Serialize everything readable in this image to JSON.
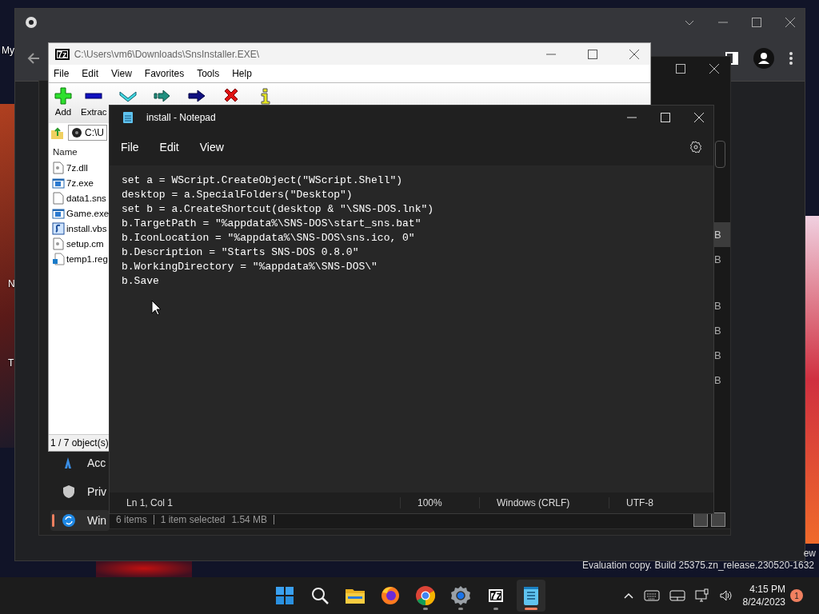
{
  "desktop": {
    "icon_labels": [
      {
        "label": "My"
      },
      {
        "label": "N"
      },
      {
        "label": "T"
      }
    ],
    "version_text": "ew",
    "build_text": "Evaluation copy. Build 25375.zn_release.230520-1632"
  },
  "settings_window": {
    "sidebar_items": [
      {
        "label": "Acc",
        "kind": "accessibility",
        "selected": false
      },
      {
        "label": "Priv",
        "kind": "privacy",
        "selected": false
      },
      {
        "label": "Win",
        "kind": "update",
        "selected": true
      }
    ]
  },
  "explorer_window": {
    "size_fragments": [
      {
        "text": "B",
        "selected": true
      },
      {
        "text": "B",
        "selected": false
      },
      {
        "text": "B",
        "selected": false
      },
      {
        "text": "B",
        "selected": false
      },
      {
        "text": "B",
        "selected": false
      },
      {
        "text": "B",
        "selected": false
      }
    ],
    "status": {
      "items": "6 items",
      "selection": "1 item selected",
      "size": "1.54 MB"
    }
  },
  "sevenzip_window": {
    "logo": "7z",
    "title": "C:\\Users\\vm6\\Downloads\\SnsInstaller.EXE\\",
    "menu": [
      "File",
      "Edit",
      "View",
      "Favorites",
      "Tools",
      "Help"
    ],
    "toolbar": [
      {
        "kind": "add",
        "label": "Add"
      },
      {
        "kind": "extract",
        "label": "Extrac"
      },
      {
        "kind": "test"
      },
      {
        "kind": "copy"
      },
      {
        "kind": "move"
      },
      {
        "kind": "delete"
      },
      {
        "kind": "info"
      }
    ],
    "address": "C:\\U",
    "column": "Name",
    "files": [
      {
        "name": "7z.dll",
        "kind": "dll",
        "selected": false
      },
      {
        "name": "7z.exe",
        "kind": "exe",
        "selected": false
      },
      {
        "name": "data1.sns",
        "kind": "file",
        "selected": false
      },
      {
        "name": "Game.exe",
        "kind": "exe",
        "selected": false
      },
      {
        "name": "install.vbs",
        "kind": "script",
        "selected": false
      },
      {
        "name": "setup.cm",
        "kind": "dll",
        "selected": false
      },
      {
        "name": "temp1.reg",
        "kind": "reg",
        "selected": false
      }
    ],
    "status": "1 / 7 object(s)"
  },
  "notepad_window": {
    "title": "install - Notepad",
    "menu": [
      "File",
      "Edit",
      "View"
    ],
    "lines": [
      "set a = WScript.CreateObject(\"WScript.Shell\")",
      "desktop = a.SpecialFolders(\"Desktop\")",
      "set b = a.CreateShortcut(desktop & \"\\SNS-DOS.lnk\")",
      "b.TargetPath = \"%appdata%\\SNS-DOS\\start_sns.bat\"",
      "b.IconLocation = \"%appdata%\\SNS-DOS\\sns.ico, 0\"",
      "b.Description = \"Starts SNS-DOS 0.8.0\"",
      "b.WorkingDirectory = \"%appdata%\\SNS-DOS\\\"",
      "b.Save"
    ],
    "status": [
      "Ln 1, Col 1",
      "100%",
      "Windows (CRLF)",
      "UTF-8"
    ]
  },
  "taskbar": {
    "apps": [
      {
        "kind": "start",
        "running": false,
        "selected": false
      },
      {
        "kind": "search",
        "running": false,
        "selected": false
      },
      {
        "kind": "files",
        "running": false,
        "selected": false
      },
      {
        "kind": "firefox",
        "running": false,
        "selected": false
      },
      {
        "kind": "chrome",
        "running": true,
        "selected": false
      },
      {
        "kind": "settings",
        "running": true,
        "selected": false
      },
      {
        "kind": "sevenzip",
        "label": "7z",
        "running": true,
        "selected": false
      },
      {
        "kind": "notepad",
        "running": true,
        "selected": true
      }
    ],
    "time": "4:15 PM",
    "date": "8/24/2023",
    "notification_count": "1"
  }
}
